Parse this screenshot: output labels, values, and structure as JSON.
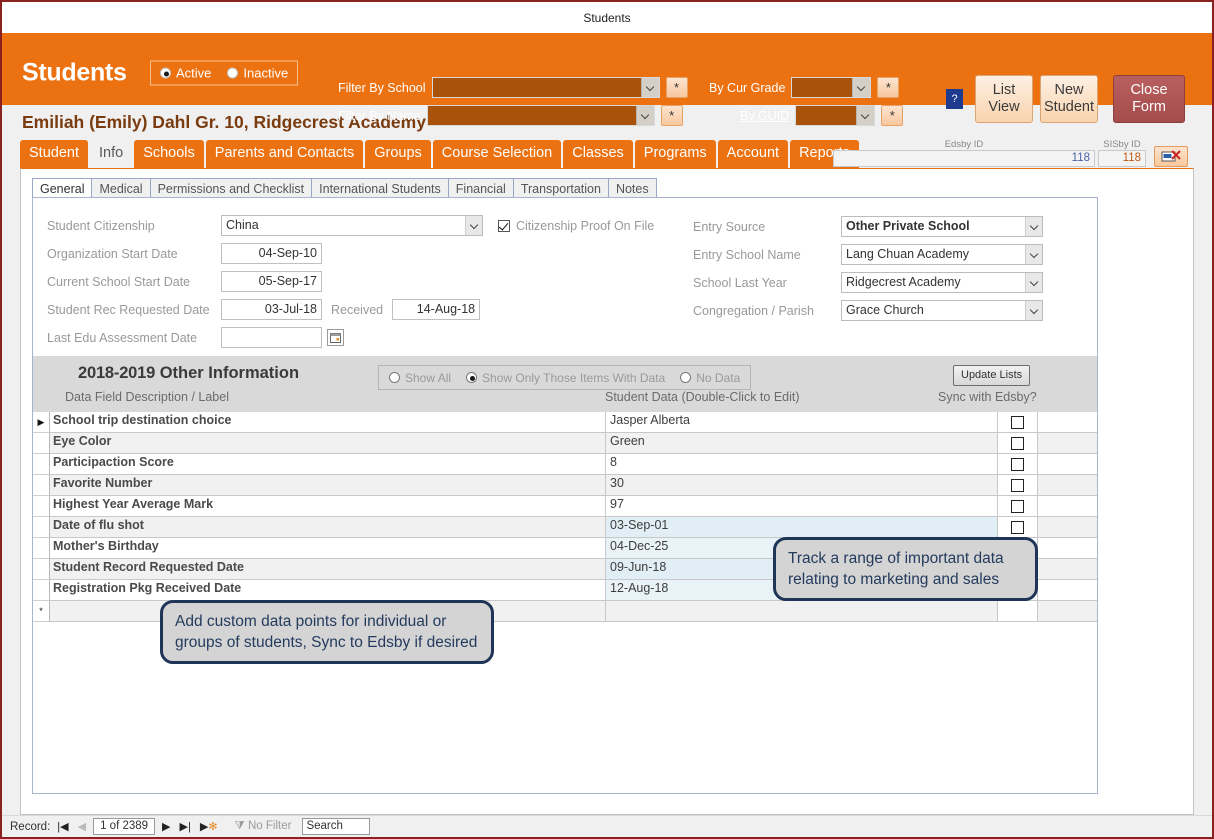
{
  "window": {
    "title": "Students"
  },
  "header": {
    "title": "Students",
    "status_filter": {
      "options": [
        "Active",
        "Inactive"
      ],
      "selected": "Active"
    },
    "filters": [
      {
        "label": "Filter By School",
        "value": "",
        "underline": false
      },
      {
        "label": "Filter By Name",
        "value": "",
        "underline": false
      },
      {
        "label": "By Cur Grade",
        "value": "",
        "underline": false
      },
      {
        "label": "By GUID",
        "value": "",
        "underline": true
      }
    ],
    "wildcard_label": "*",
    "help_label": "?",
    "buttons": {
      "list_view": "List View",
      "new_student": "New Student",
      "close_form": "Close Form"
    }
  },
  "student": {
    "name_line": "Emiliah (Emily)  Dahl  Gr. 10, Ridgecrest Academy"
  },
  "main_tabs": {
    "items": [
      "Student",
      "Info",
      "Schools",
      "Parents and Contacts",
      "Groups",
      "Course Selection",
      "Classes",
      "Programs",
      "Account",
      "Reports"
    ],
    "selected": "Info"
  },
  "ids": {
    "edsby_caption": "Edsby ID",
    "sisby_caption": "SISby ID",
    "edsby_value": "118",
    "sisby_value": "118"
  },
  "sub_tabs": {
    "items": [
      "General",
      "Medical",
      "Permissions and Checklist",
      "International Students",
      "Financial",
      "Transportation",
      "Notes"
    ],
    "selected": "General"
  },
  "form": {
    "left": [
      {
        "label": "Student Citizenship",
        "value": "China",
        "type": "select"
      },
      {
        "label": "Organization Start Date",
        "value": "04-Sep-10",
        "type": "date"
      },
      {
        "label": "Current  School Start Date",
        "value": "05-Sep-17",
        "type": "date"
      },
      {
        "label": "Student Rec Requested Date",
        "value": "03-Jul-18",
        "type": "date"
      },
      {
        "label": "Last Edu Assessment Date",
        "value": "",
        "type": "date"
      }
    ],
    "received_label": "Received",
    "received_value": "14-Aug-18",
    "citizenship_proof": {
      "label": "Citizenship Proof On File",
      "checked": true
    },
    "right": [
      {
        "label": "Entry Source",
        "value": "Other Private School"
      },
      {
        "label": "Entry School Name",
        "value": "Lang Chuan Academy"
      },
      {
        "label": "School Last Year",
        "value": "Ridgecrest Academy"
      },
      {
        "label": "Congregation / Parish",
        "value": "Grace Church"
      }
    ]
  },
  "other_information": {
    "year": "2018-2019",
    "title": "Other Information",
    "view_options": {
      "options": [
        "Show All",
        "Show Only Those Items With Data",
        "No Data"
      ],
      "selected": "Show Only Those Items With Data"
    },
    "update_lists_label": "Update Lists",
    "columns": {
      "description": "Data Field Description / Label",
      "data": "Student Data (Double-Click to Edit)",
      "sync": "Sync with Edsby?"
    },
    "rows": [
      {
        "description": "School trip destination choice",
        "data": "Jasper Alberta",
        "sync": false,
        "current": true,
        "highlight": false
      },
      {
        "description": "Eye Color",
        "data": "Green",
        "sync": false,
        "current": false,
        "highlight": false
      },
      {
        "description": "Participaction Score",
        "data": "8",
        "sync": false,
        "current": false,
        "highlight": false
      },
      {
        "description": "Favorite Number",
        "data": "30",
        "sync": false,
        "current": false,
        "highlight": false
      },
      {
        "description": "Highest Year Average Mark",
        "data": "97",
        "sync": false,
        "current": false,
        "highlight": false
      },
      {
        "description": "Date of flu shot",
        "data": "03-Sep-01",
        "sync": false,
        "current": false,
        "highlight": true
      },
      {
        "description": "Mother's Birthday",
        "data": "04-Dec-25",
        "sync": false,
        "current": false,
        "highlight": true
      },
      {
        "description": "Student Record Requested Date",
        "data": "09-Jun-18",
        "sync": false,
        "current": false,
        "highlight": true
      },
      {
        "description": "Registration Pkg Received Date",
        "data": "12-Aug-18",
        "sync": false,
        "current": false,
        "highlight": true
      }
    ],
    "new_row_marker": "*"
  },
  "callouts": [
    {
      "id": "callout-custom-data",
      "text": "Add custom data points for individual or groups of students, Sync to Edsby if desired"
    },
    {
      "id": "callout-marketing",
      "text": "Track a range of important data relating to marketing and sales"
    }
  ],
  "status_bar": {
    "record_label": "Record:",
    "record_value": "1 of 2389",
    "filter_label": "No Filter",
    "search_value": "Search"
  },
  "colors": {
    "accent": "#ec7211",
    "window_border": "#8b2020",
    "close_button": "#a44d4c",
    "callout_border": "#1f3557",
    "highlight_row": "#e8f2f7"
  }
}
